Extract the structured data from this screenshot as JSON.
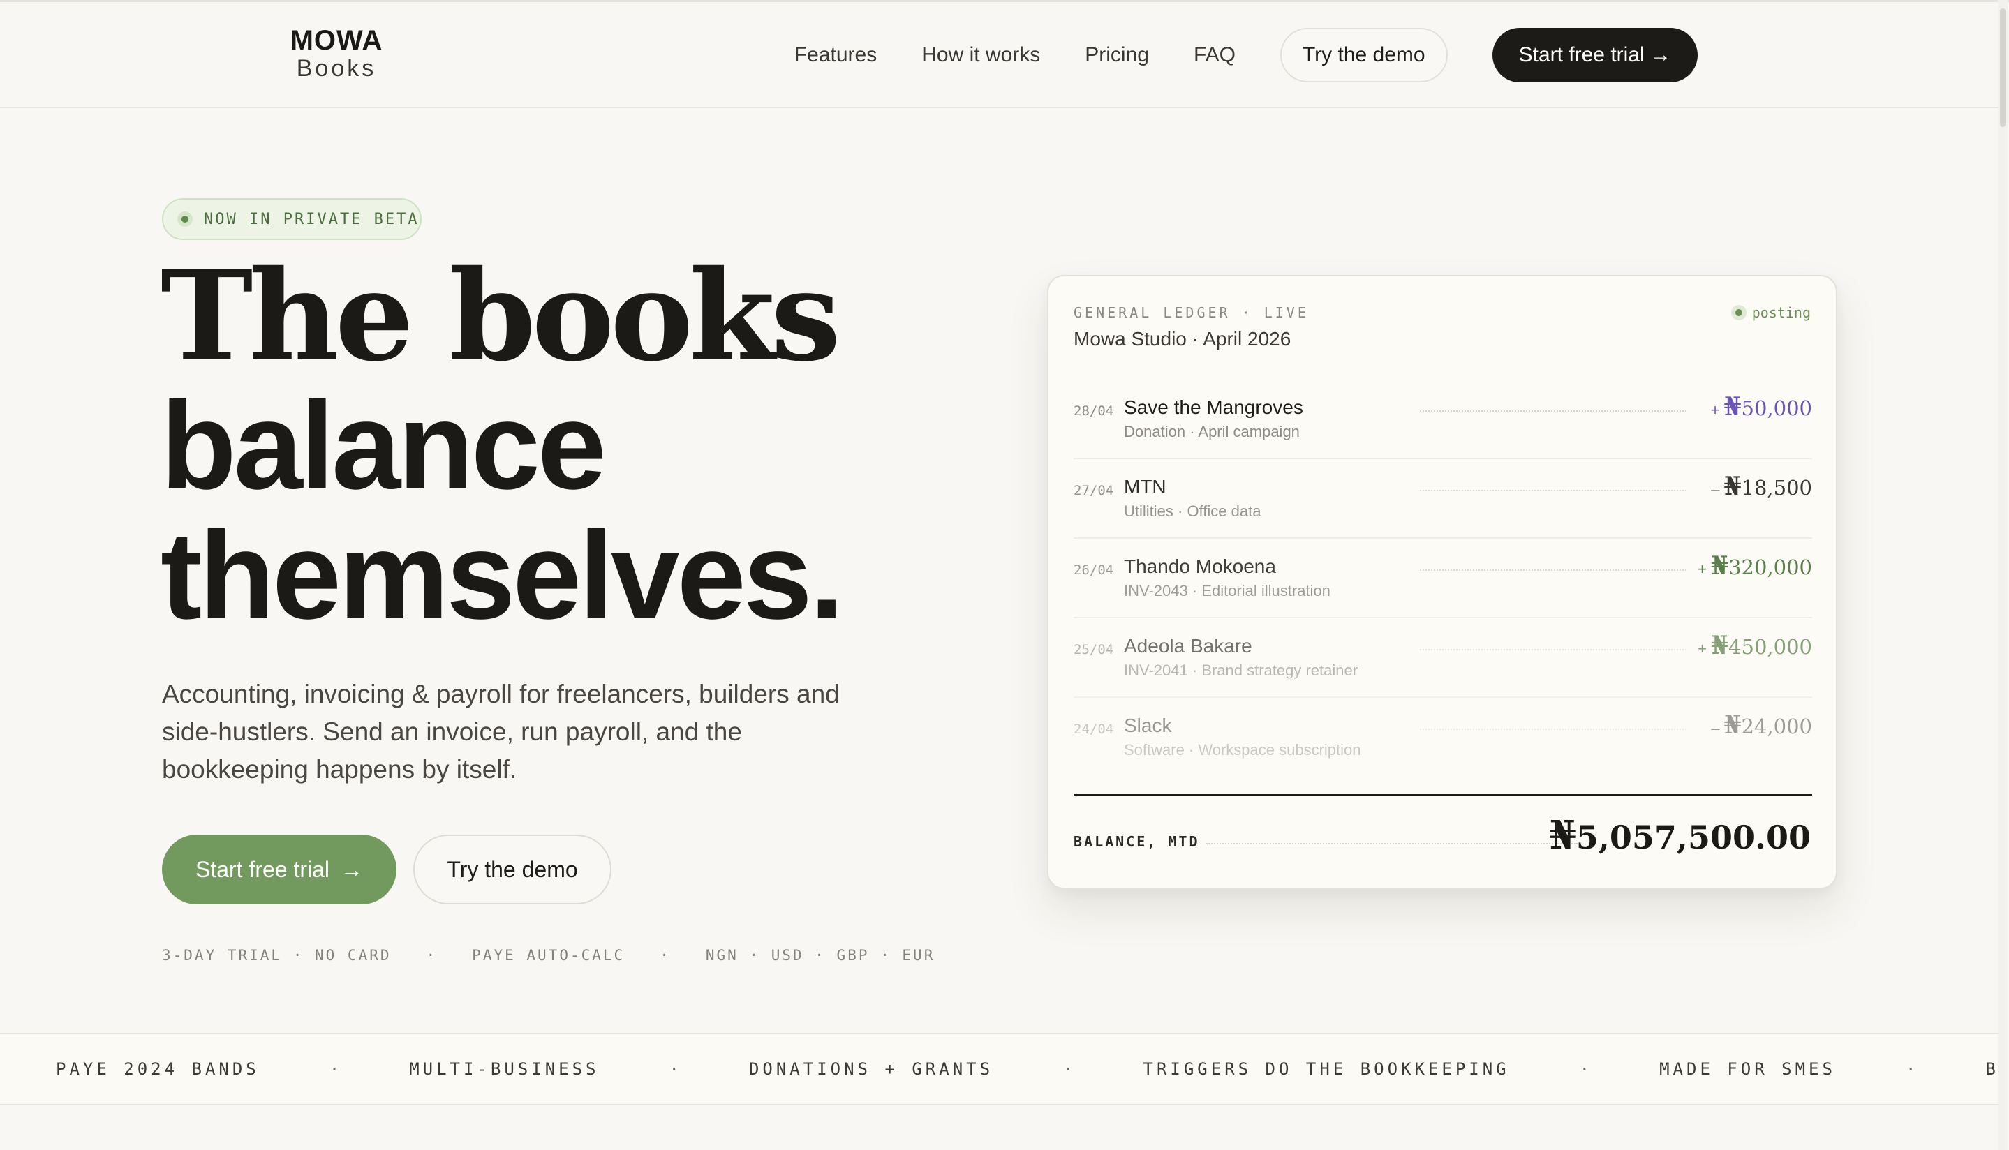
{
  "nav": {
    "logo_top": "MOWA",
    "logo_bottom": "Books",
    "links": [
      "Features",
      "How it works",
      "Pricing",
      "FAQ"
    ],
    "demo_label": "Try the demo",
    "trial_label": "Start free trial →"
  },
  "hero": {
    "badge": "NOW IN PRIVATE BETA",
    "headline_1": "The books",
    "headline_2": "balance",
    "headline_3": "themselves.",
    "subtitle": "Accounting, invoicing & payroll for freelancers, builders and side-hustlers. Send an invoice, run payroll, and the bookkeeping happens by itself.",
    "cta_trial": "Start free trial",
    "cta_arrow": "→",
    "cta_demo": "Try the demo",
    "facts": [
      "3-DAY TRIAL · NO CARD",
      "PAYE AUTO-CALC",
      "NGN · USD · GBP · EUR"
    ],
    "facts_separator": "·"
  },
  "ledger": {
    "eyebrow": "GENERAL LEDGER · LIVE",
    "status": "posting",
    "title": "Mowa Studio · April 2026",
    "currency": "₦",
    "entries": [
      {
        "date": "28/04",
        "name": "Save the Mangroves",
        "meta": "Donation · April campaign",
        "sign": "+",
        "amount": "50,000",
        "color": "#6b55b3"
      },
      {
        "date": "27/04",
        "name": "MTN",
        "meta": "Utilities · Office data",
        "sign": "–",
        "amount": "18,500",
        "color": "#2a2824"
      },
      {
        "date": "26/04",
        "name": "Thando Mokoena",
        "meta": "INV-2043 · Editorial illustration",
        "sign": "+",
        "amount": "320,000",
        "color": "#3f6a2e"
      },
      {
        "date": "25/04",
        "name": "Adeola Bakare",
        "meta": "INV-2041 · Brand strategy retainer",
        "sign": "+",
        "amount": "450,000",
        "color": "#3f6a2e"
      },
      {
        "date": "24/04",
        "name": "Slack",
        "meta": "Software · Workspace subscription",
        "sign": "–",
        "amount": "24,000",
        "color": "#2a2824"
      }
    ],
    "balance_label": "BALANCE, MTD",
    "balance_value": "5,057,500.00"
  },
  "marquee": {
    "items": [
      "PAYE 2024 BANDS",
      "MULTI-BUSINESS",
      "DONATIONS + GRANTS",
      "TRIGGERS DO THE BOOKKEEPING",
      "MADE FOR SMES",
      "BUILT IN L"
    ],
    "separator": "·"
  }
}
